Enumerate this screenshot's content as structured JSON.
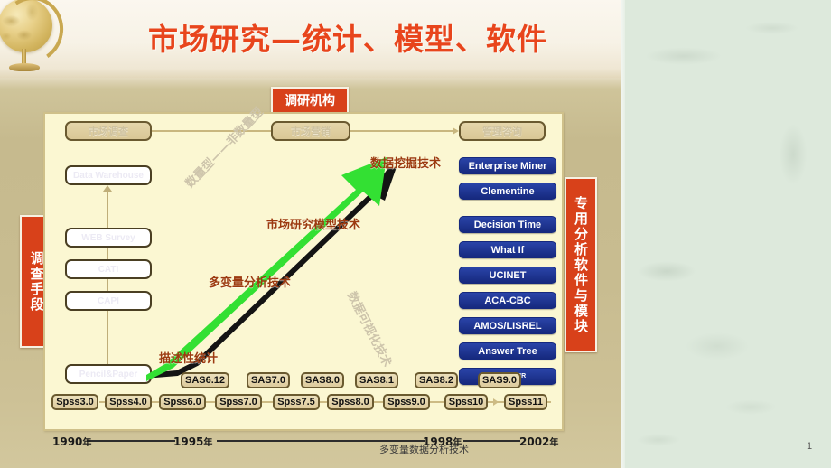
{
  "slide": {
    "title": "市场研究—统计、模型、软件",
    "page_number": "1",
    "footer_note": "多变量数据分析技术",
    "accent_red": "#d8411a",
    "title_color": "#e8451c",
    "panel_bg": "#fbf7d2",
    "software_blue": "#1b2f8c",
    "arrow_green": "#33e033"
  },
  "labels": {
    "agency": "调研机构",
    "survey_methods": "调查手段",
    "analysis_software": "专用分析软件与模块"
  },
  "stages": [
    {
      "label": "市场调查"
    },
    {
      "label": "市场营销"
    },
    {
      "label": "管理咨询"
    }
  ],
  "methods": [
    {
      "label": "Data Warehouse"
    },
    {
      "label": "WEB Survey"
    },
    {
      "label": "CATI"
    },
    {
      "label": "CAPI"
    },
    {
      "label": "Pencil&Paper"
    }
  ],
  "arrow_labels": [
    {
      "label": "数据挖掘技术"
    },
    {
      "label": "市场研究模型技术"
    },
    {
      "label": "多变量分析技术"
    },
    {
      "label": "描述性统计"
    }
  ],
  "faded_labels": [
    {
      "label": "数量型——非数量型"
    },
    {
      "label": "数据可视化技术"
    }
  ],
  "software": [
    {
      "label": "Enterprise Miner"
    },
    {
      "label": "Clementine"
    },
    {
      "label": "Decision Time"
    },
    {
      "label": "What If"
    },
    {
      "label": "UCINET"
    },
    {
      "label": "ACA-CBC"
    },
    {
      "label": "AMOS/LISREL"
    },
    {
      "label": "Answer Tree"
    },
    {
      "label": "SPSS",
      "sup": "MR"
    }
  ],
  "sas_versions": [
    {
      "label": "SAS6.12"
    },
    {
      "label": "SAS7.0"
    },
    {
      "label": "SAS8.0"
    },
    {
      "label": "SAS8.1"
    },
    {
      "label": "SAS8.2"
    },
    {
      "label": "SAS9.0"
    }
  ],
  "spss_versions": [
    {
      "label": "Spss3.0"
    },
    {
      "label": "Spss4.0"
    },
    {
      "label": "Spss6.0"
    },
    {
      "label": "Spss7.0"
    },
    {
      "label": "Spss7.5"
    },
    {
      "label": "Spss8.0"
    },
    {
      "label": "Spss9.0"
    },
    {
      "label": "Spss10"
    },
    {
      "label": "Spss11"
    }
  ],
  "timeline": [
    {
      "year": "1990",
      "unit": "年"
    },
    {
      "year": "1995",
      "unit": "年"
    },
    {
      "year": "1998",
      "unit": "年"
    },
    {
      "year": "2002",
      "unit": "年"
    }
  ]
}
